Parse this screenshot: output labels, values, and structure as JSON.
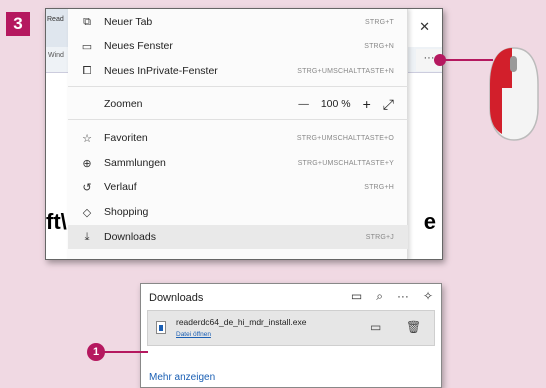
{
  "step_number": "3",
  "browser_bg": {
    "tab_text": "Read",
    "addr_text": "Wind",
    "close_glyph": "✕",
    "more_glyph": "···",
    "heading_left": "ft\\",
    "heading_right": "e"
  },
  "menu": {
    "items": [
      {
        "icon": "new-tab-icon",
        "glyph": "⧉",
        "label": "Neuer Tab",
        "shortcut": "STRG+T"
      },
      {
        "icon": "new-window-icon",
        "glyph": "▭",
        "label": "Neues Fenster",
        "shortcut": "STRG+N"
      },
      {
        "icon": "inprivate-icon",
        "glyph": "⧠",
        "label": "Neues InPrivate-Fenster",
        "shortcut": "STRG+UMSCHALTTASTE+N"
      },
      {
        "icon": "star-list-icon",
        "glyph": "☆",
        "label": "Favoriten",
        "shortcut": "STRG+UMSCHALTTASTE+O"
      },
      {
        "icon": "collections-icon",
        "glyph": "⊕",
        "label": "Sammlungen",
        "shortcut": "STRG+UMSCHALTTASTE+Y"
      },
      {
        "icon": "history-icon",
        "glyph": "↺",
        "label": "Verlauf",
        "shortcut": "STRG+H"
      },
      {
        "icon": "shopping-icon",
        "glyph": "◇",
        "label": "Shopping",
        "shortcut": ""
      },
      {
        "icon": "download-icon",
        "glyph": "⤓",
        "label": "Downloads",
        "shortcut": "STRG+J"
      }
    ],
    "zoom": {
      "label": "Zoomen",
      "minus": "—",
      "value": "100 %",
      "plus": "+",
      "fullscreen": "⤢"
    }
  },
  "downloads_panel": {
    "title": "Downloads",
    "header_icons": [
      "folder-icon",
      "search-icon",
      "more-icon",
      "pin-icon"
    ],
    "header_glyphs": [
      "▭",
      "⌕",
      "···",
      "✧"
    ],
    "file_name": "readerdc64_de_hi_mdr_install.exe",
    "open_link": "Datei öffnen",
    "folder_glyph": "▭",
    "trash_glyph": "🗑",
    "more_label": "Mehr anzeigen"
  },
  "callout_number": "1",
  "colors": {
    "accent": "#b5185f",
    "background": "#f0d9e3",
    "link": "#1a5fb4"
  }
}
